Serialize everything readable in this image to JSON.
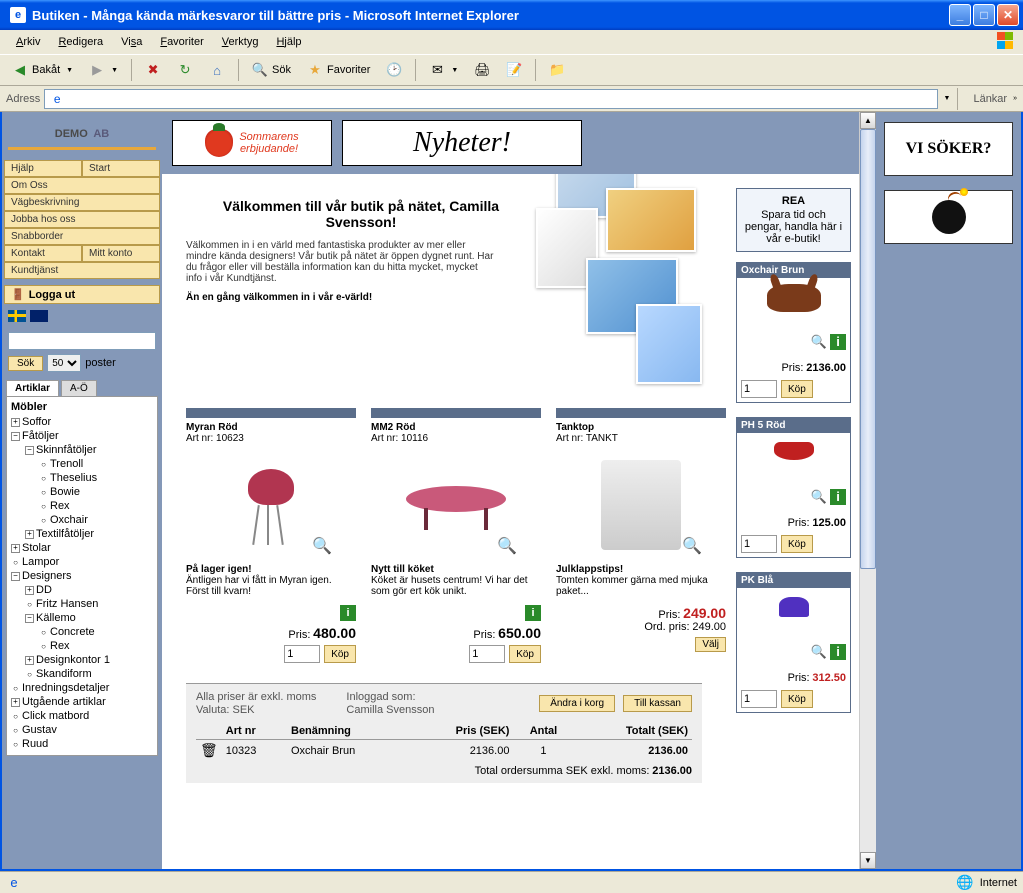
{
  "window": {
    "title": "Butiken - Många kända märkesvaror till bättre pris - Microsoft Internet Explorer"
  },
  "menubar": {
    "arkiv": "Arkiv",
    "redigera": "Redigera",
    "visa": "Visa",
    "favoriter": "Favoriter",
    "verktyg": "Verktyg",
    "hjalp": "Hjälp"
  },
  "toolbar": {
    "back": "Bakåt",
    "search": "Sök",
    "favs": "Favoriter"
  },
  "addressbar": {
    "label": "Adress",
    "links": "Länkar"
  },
  "logo": {
    "text": "DEMO",
    "suffix": "AB"
  },
  "nav": {
    "hjalp": "Hjälp",
    "start": "Start",
    "omoss": "Om Oss",
    "vag": "Vägbeskrivning",
    "jobba": "Jobba hos oss",
    "snabb": "Snabborder",
    "kontakt": "Kontakt",
    "mitt": "Mitt konto",
    "kund": "Kundtjänst",
    "logout": "Logga ut"
  },
  "search": {
    "btn": "Sök",
    "poster": "poster",
    "count": "50"
  },
  "tabs": {
    "artiklar": "Artiklar",
    "aoe": "A-Ö"
  },
  "tree": {
    "title": "Möbler",
    "soffor": "Soffor",
    "fatoljer": "Fåtöljer",
    "skinn": "Skinnfåtöljer",
    "trenoll": "Trenoll",
    "theselius": "Theselius",
    "bowie": "Bowie",
    "rex": "Rex",
    "oxchair": "Oxchair",
    "textil": "Textilfåtöljer",
    "stolar": "Stolar",
    "lampor": "Lampor",
    "designers": "Designers",
    "dd": "DD",
    "fritz": "Fritz Hansen",
    "kallemo": "Källemo",
    "concrete": "Concrete",
    "rex2": "Rex",
    "designkontor": "Designkontor 1",
    "skandiform": "Skandiform",
    "inred": "Inredningsdetaljer",
    "utg": "Utgående artiklar",
    "click": "Click matbord",
    "gustav": "Gustav",
    "ruud": "Ruud"
  },
  "banners": {
    "sommar": "Sommarens\nerbjudande!",
    "nyheter": "Nyheter!",
    "visoker": "VI SÖKER?"
  },
  "welcome": {
    "title": "Välkommen till vår butik på nätet, Camilla Svensson!",
    "text": "Välkommen in i en värld med fantastiska produkter av mer eller mindre kända designers! Vår butik på nätet är öppen dygnet runt. Har du frågor eller vill beställa information kan du hitta mycket, mycket info i vår Kundtjänst.",
    "bold": "Än en gång välkommen in i vår e-värld!"
  },
  "products": [
    {
      "name": "Myran Röd",
      "art": "Art nr: 10623",
      "promoTitle": "På lager igen!",
      "promo": "Äntligen har vi fått in Myran igen. Först till kvarn!",
      "priceLabel": "Pris:",
      "price": "480.00",
      "qty": "1",
      "btn": "Köp"
    },
    {
      "name": "MM2 Röd",
      "art": "Art nr: 10116",
      "promoTitle": "Nytt till köket",
      "promo": "Köket är husets centrum! Vi har det som gör ert kök unikt.",
      "priceLabel": "Pris:",
      "price": "650.00",
      "qty": "1",
      "btn": "Köp"
    },
    {
      "name": "Tanktop",
      "art": "Art nr: TANKT",
      "promoTitle": "Julklappstips!",
      "promo": "Tomten kommer gärna med mjuka paket...",
      "priceLabel": "Pris:",
      "price": "249.00",
      "ordLabel": "Ord. pris:",
      "ordPrice": "249.00",
      "btn": "Välj"
    }
  ],
  "rea": {
    "title": "REA",
    "text": "Spara tid och pengar, handla här i vår e-butik!"
  },
  "minis": [
    {
      "name": "Oxchair Brun",
      "priceLabel": "Pris:",
      "price": "2136.00",
      "qty": "1",
      "btn": "Köp"
    },
    {
      "name": "PH 5 Röd",
      "priceLabel": "Pris:",
      "price": "125.00",
      "qty": "1",
      "btn": "Köp"
    },
    {
      "name": "PK Blå",
      "priceLabel": "Pris:",
      "price": "312.50",
      "qty": "1",
      "btn": "Köp",
      "red": true
    }
  ],
  "cartFooter": {
    "moms": "Alla priser är exkl. moms",
    "valuta": "Valuta: SEK",
    "inlog1": "Inloggad som:",
    "inlog2": "Camilla Svensson",
    "andra": "Ändra i korg",
    "kassan": "Till kassan",
    "h_art": "Art nr",
    "h_ben": "Benämning",
    "h_pris": "Pris (SEK)",
    "h_antal": "Antal",
    "h_tot": "Totalt (SEK)",
    "row_art": "10323",
    "row_ben": "Oxchair Brun",
    "row_pris": "2136.00",
    "row_antal": "1",
    "row_tot": "2136.00",
    "sum_label": "Total ordersumma SEK exkl. moms:",
    "sum": "2136.00"
  },
  "statusbar": {
    "zone": "Internet"
  }
}
